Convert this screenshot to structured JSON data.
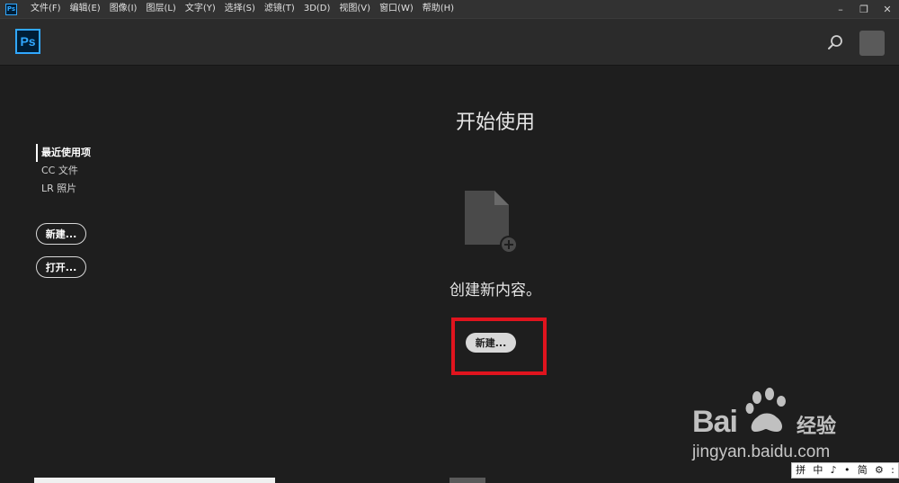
{
  "menubar": {
    "app_icon_label": "Ps",
    "items": [
      "文件(F)",
      "编辑(E)",
      "图像(I)",
      "图层(L)",
      "文字(Y)",
      "选择(S)",
      "滤镜(T)",
      "3D(D)",
      "视图(V)",
      "窗口(W)",
      "帮助(H)"
    ],
    "window_controls": [
      "–",
      "❐",
      "✕"
    ]
  },
  "header": {
    "logo_label": "Ps",
    "search_icon": "search-icon"
  },
  "sidebar": {
    "items": [
      "最近使用项",
      "CC 文件",
      "LR 照片"
    ],
    "new_button": "新建...",
    "open_button": "打开..."
  },
  "main": {
    "title": "开始使用",
    "create_text": "创建新内容。",
    "new_button": "新建...",
    "doc_icon": "new-document-icon"
  },
  "watermark": {
    "logo_text": "Bai",
    "logo_suffix": "经验",
    "url": "jingyan.baidu.com"
  },
  "ime": {
    "items": [
      "拼",
      "中",
      "♪",
      "•",
      "简",
      "⚙",
      ":"
    ]
  },
  "colors": {
    "accent": "#31a8ff",
    "highlight": "#e0141e",
    "background": "#1e1e1e"
  }
}
